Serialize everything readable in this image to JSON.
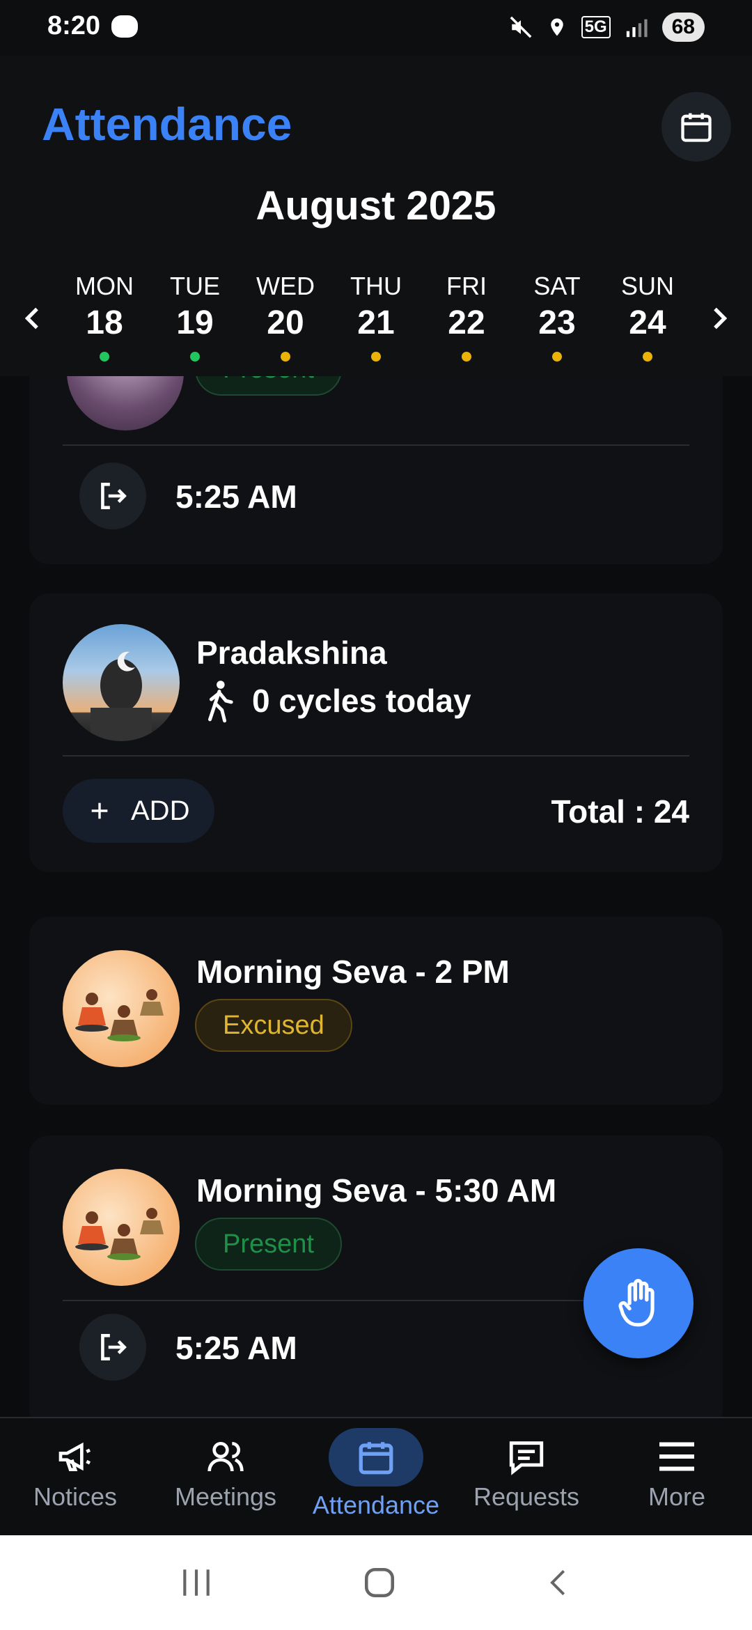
{
  "status_bar": {
    "time": "8:20",
    "network": "5G",
    "battery": "68"
  },
  "header": {
    "title": "Attendance",
    "month": "August 2025",
    "days": [
      {
        "name": "MON",
        "date": "18",
        "dot": "#22c55e"
      },
      {
        "name": "TUE",
        "date": "19",
        "dot": "#22c55e"
      },
      {
        "name": "WED",
        "date": "20",
        "dot": "#eab308"
      },
      {
        "name": "THU",
        "date": "21",
        "dot": "#eab308"
      },
      {
        "name": "FRI",
        "date": "22",
        "dot": "#eab308"
      },
      {
        "name": "SAT",
        "date": "23",
        "dot": "#eab308"
      },
      {
        "name": "SUN",
        "date": "24",
        "dot": "#eab308"
      }
    ]
  },
  "cards": {
    "top_partial": {
      "status": "Present",
      "checkout_time": "5:25 AM"
    },
    "pradakshina": {
      "title": "Pradakshina",
      "cycles": "0 cycles today",
      "add_label": "ADD",
      "total": "Total : 24"
    },
    "seva_2pm": {
      "title": "Morning Seva - 2 PM",
      "status": "Excused"
    },
    "seva_530": {
      "title": "Morning Seva - 5:30 AM",
      "status": "Present",
      "checkout_time": "5:25 AM"
    }
  },
  "bottom_nav": {
    "items": [
      {
        "label": "Notices",
        "icon": "megaphone-icon"
      },
      {
        "label": "Meetings",
        "icon": "people-icon"
      },
      {
        "label": "Attendance",
        "icon": "calendar-icon",
        "active": true
      },
      {
        "label": "Requests",
        "icon": "message-square-icon"
      },
      {
        "label": "More",
        "icon": "menu-icon"
      }
    ]
  },
  "colors": {
    "accent": "#3b82f6",
    "present": "#1f8f4a",
    "excused": "#e0b630"
  }
}
